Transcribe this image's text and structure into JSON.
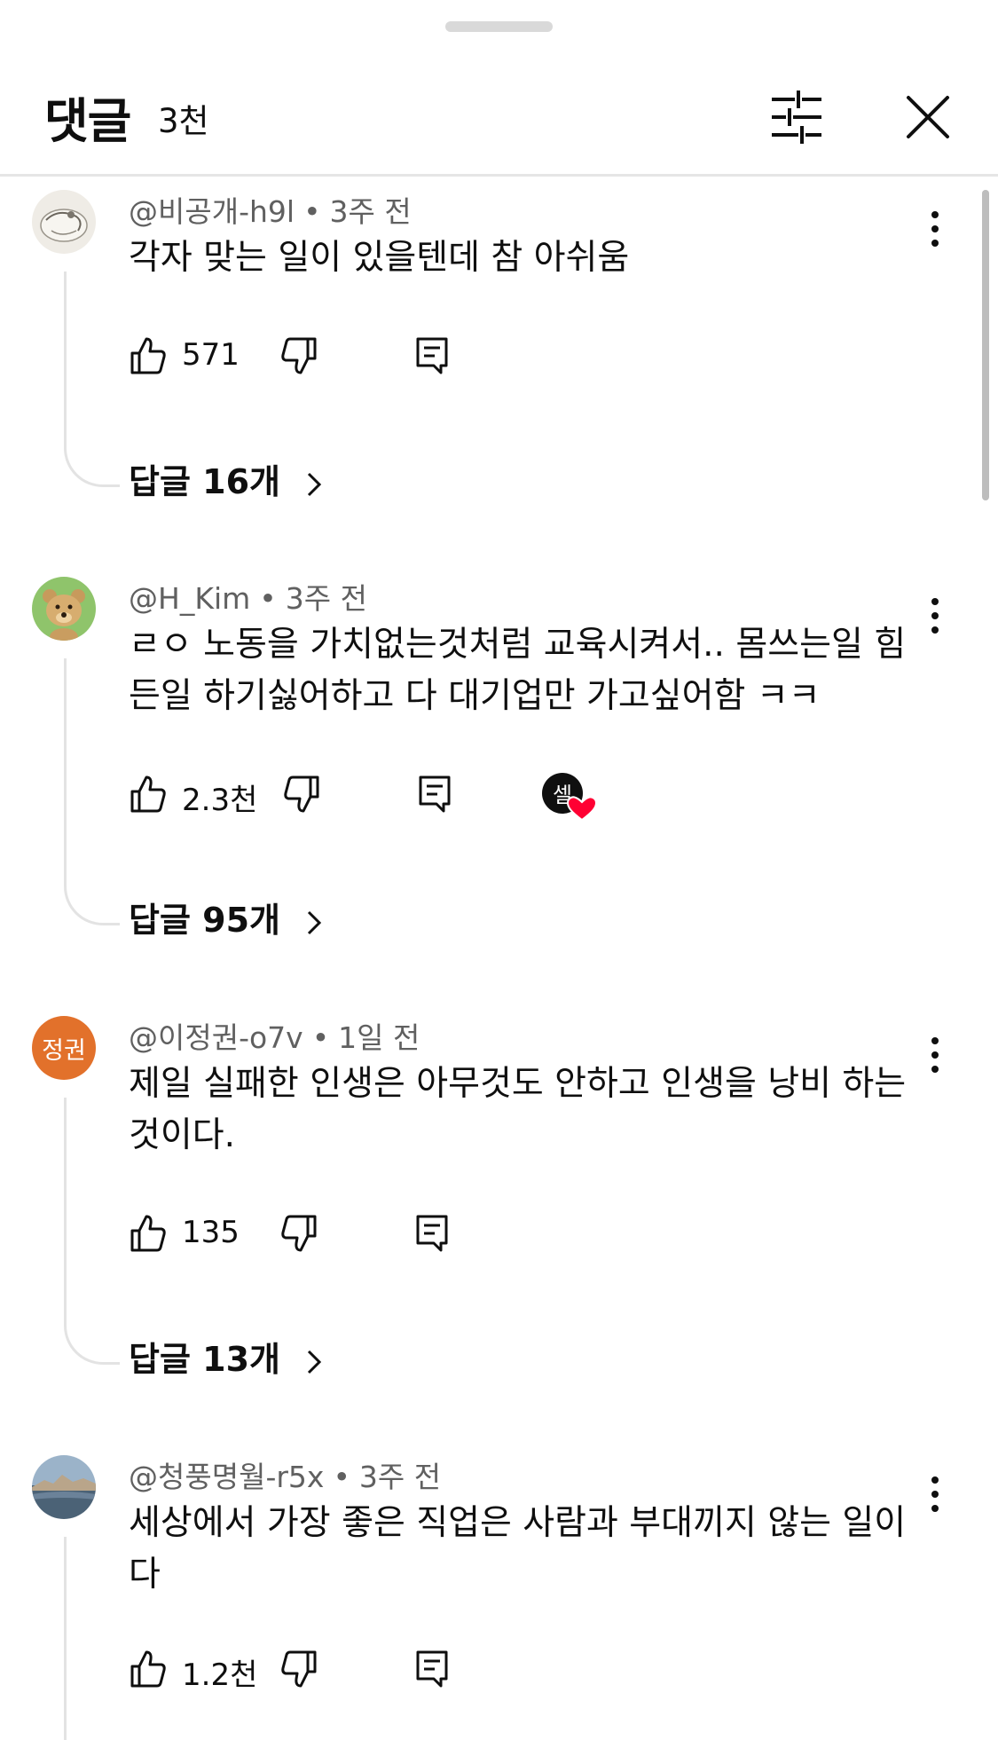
{
  "header": {
    "title": "댓글",
    "count": "3천"
  },
  "comments": [
    {
      "author": "@비공개-h9l",
      "time": "3주 전",
      "text": "각자 맞는 일이 있을텐데 참 아쉬움",
      "likes": "571",
      "replies": "답글 16개",
      "avatar": "sketch"
    },
    {
      "author": "@H_Kim",
      "time": "3주 전",
      "text": "ㄹㅇ 노동을 가치없는것처럼 교육시켜서.. 몸쓰는일 힘든일 하기싫어하고 다 대기업만 가고싶어함 ㅋㅋ",
      "likes": "2.3천",
      "replies": "답글 95개",
      "creator_heart_label": "셀",
      "avatar": "bear"
    },
    {
      "author": "@이정권-o7v",
      "time": "1일 전",
      "text": "제일 실패한 인생은 아무것도 안하고 인생을 낭비 하는 것이다.",
      "likes": "135",
      "replies": "답글 13개",
      "avatar_initials": "정권",
      "avatar": "initials"
    },
    {
      "author": "@청풍명월-r5x",
      "time": "3주 전",
      "text": "세상에서 가장 좋은 직업은 사람과 부대끼지 않는 일이다",
      "likes": "1.2천",
      "avatar": "landscape"
    }
  ],
  "colors": {
    "initials_avatar": "#e2712b",
    "heart": "#ff0033",
    "secondary_text": "#606060"
  }
}
